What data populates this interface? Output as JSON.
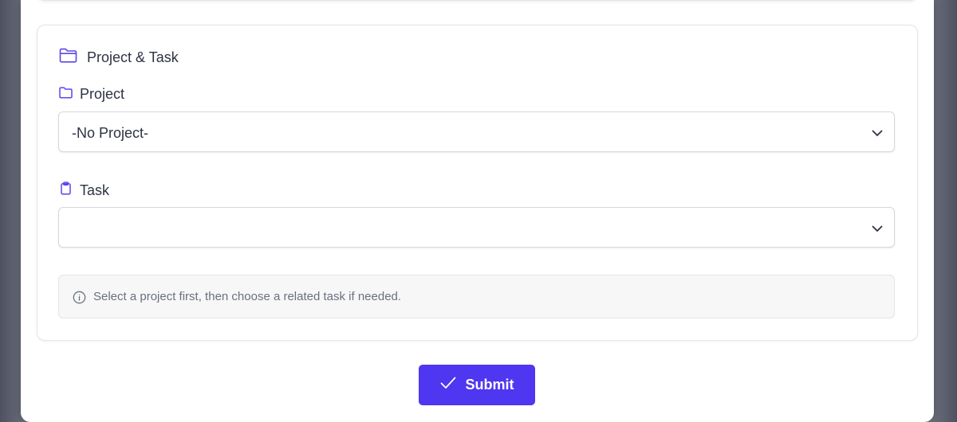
{
  "section": {
    "title": "Project & Task",
    "icon": "folder-open-icon"
  },
  "project": {
    "label": "Project",
    "icon": "folder-icon",
    "value": "-No Project-"
  },
  "task": {
    "label": "Task",
    "icon": "clipboard-icon",
    "value": ""
  },
  "info": {
    "icon": "info-icon",
    "text": "Select a project first, then choose a related task if needed."
  },
  "submit": {
    "label": "Submit",
    "icon": "check-icon"
  },
  "colors": {
    "accent": "#4f36f0",
    "icon": "#5b45ea",
    "text": "#2d3342",
    "muted": "#6a7080"
  }
}
